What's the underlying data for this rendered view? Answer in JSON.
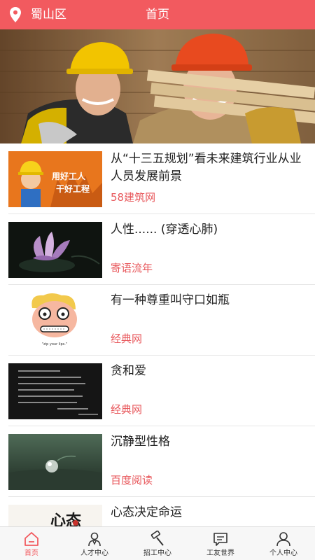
{
  "header": {
    "location": "蜀山区",
    "title": "首页",
    "location_icon": "location-pin-icon",
    "bg_color": "#f25a5f"
  },
  "banner": {
    "image": "two smiling construction workers in hard hats carrying lumber"
  },
  "articles": [
    {
      "title": "从“十三五规划”看未来建筑行业从业人员发展前景",
      "source": "58建筑网",
      "thumb_text_1": "用好工人",
      "thumb_text_2": "干好工程"
    },
    {
      "title": "人性...... (穿透心肺)",
      "source": "寄语流年"
    },
    {
      "title": "有一种尊重叫守口如瓶",
      "source": "经典网",
      "thumb_caption": "\"zip your lips.\""
    },
    {
      "title": "贪和爱",
      "source": "经典网"
    },
    {
      "title": "沉静型性格",
      "source": "百度阅读"
    },
    {
      "title": "心态决定命运",
      "source": "",
      "thumb_text": "心态"
    }
  ],
  "tabs": [
    {
      "label": "首页",
      "icon": "home-icon",
      "active": true
    },
    {
      "label": "人才中心",
      "icon": "talent-person-icon",
      "active": false
    },
    {
      "label": "招工中心",
      "icon": "hammer-tool-icon",
      "active": false
    },
    {
      "label": "工友世界",
      "icon": "chat-bubble-icon",
      "active": false
    },
    {
      "label": "个人中心",
      "icon": "user-profile-icon",
      "active": false
    }
  ],
  "colors": {
    "accent": "#f25a5f",
    "source_text": "#e8585c"
  }
}
